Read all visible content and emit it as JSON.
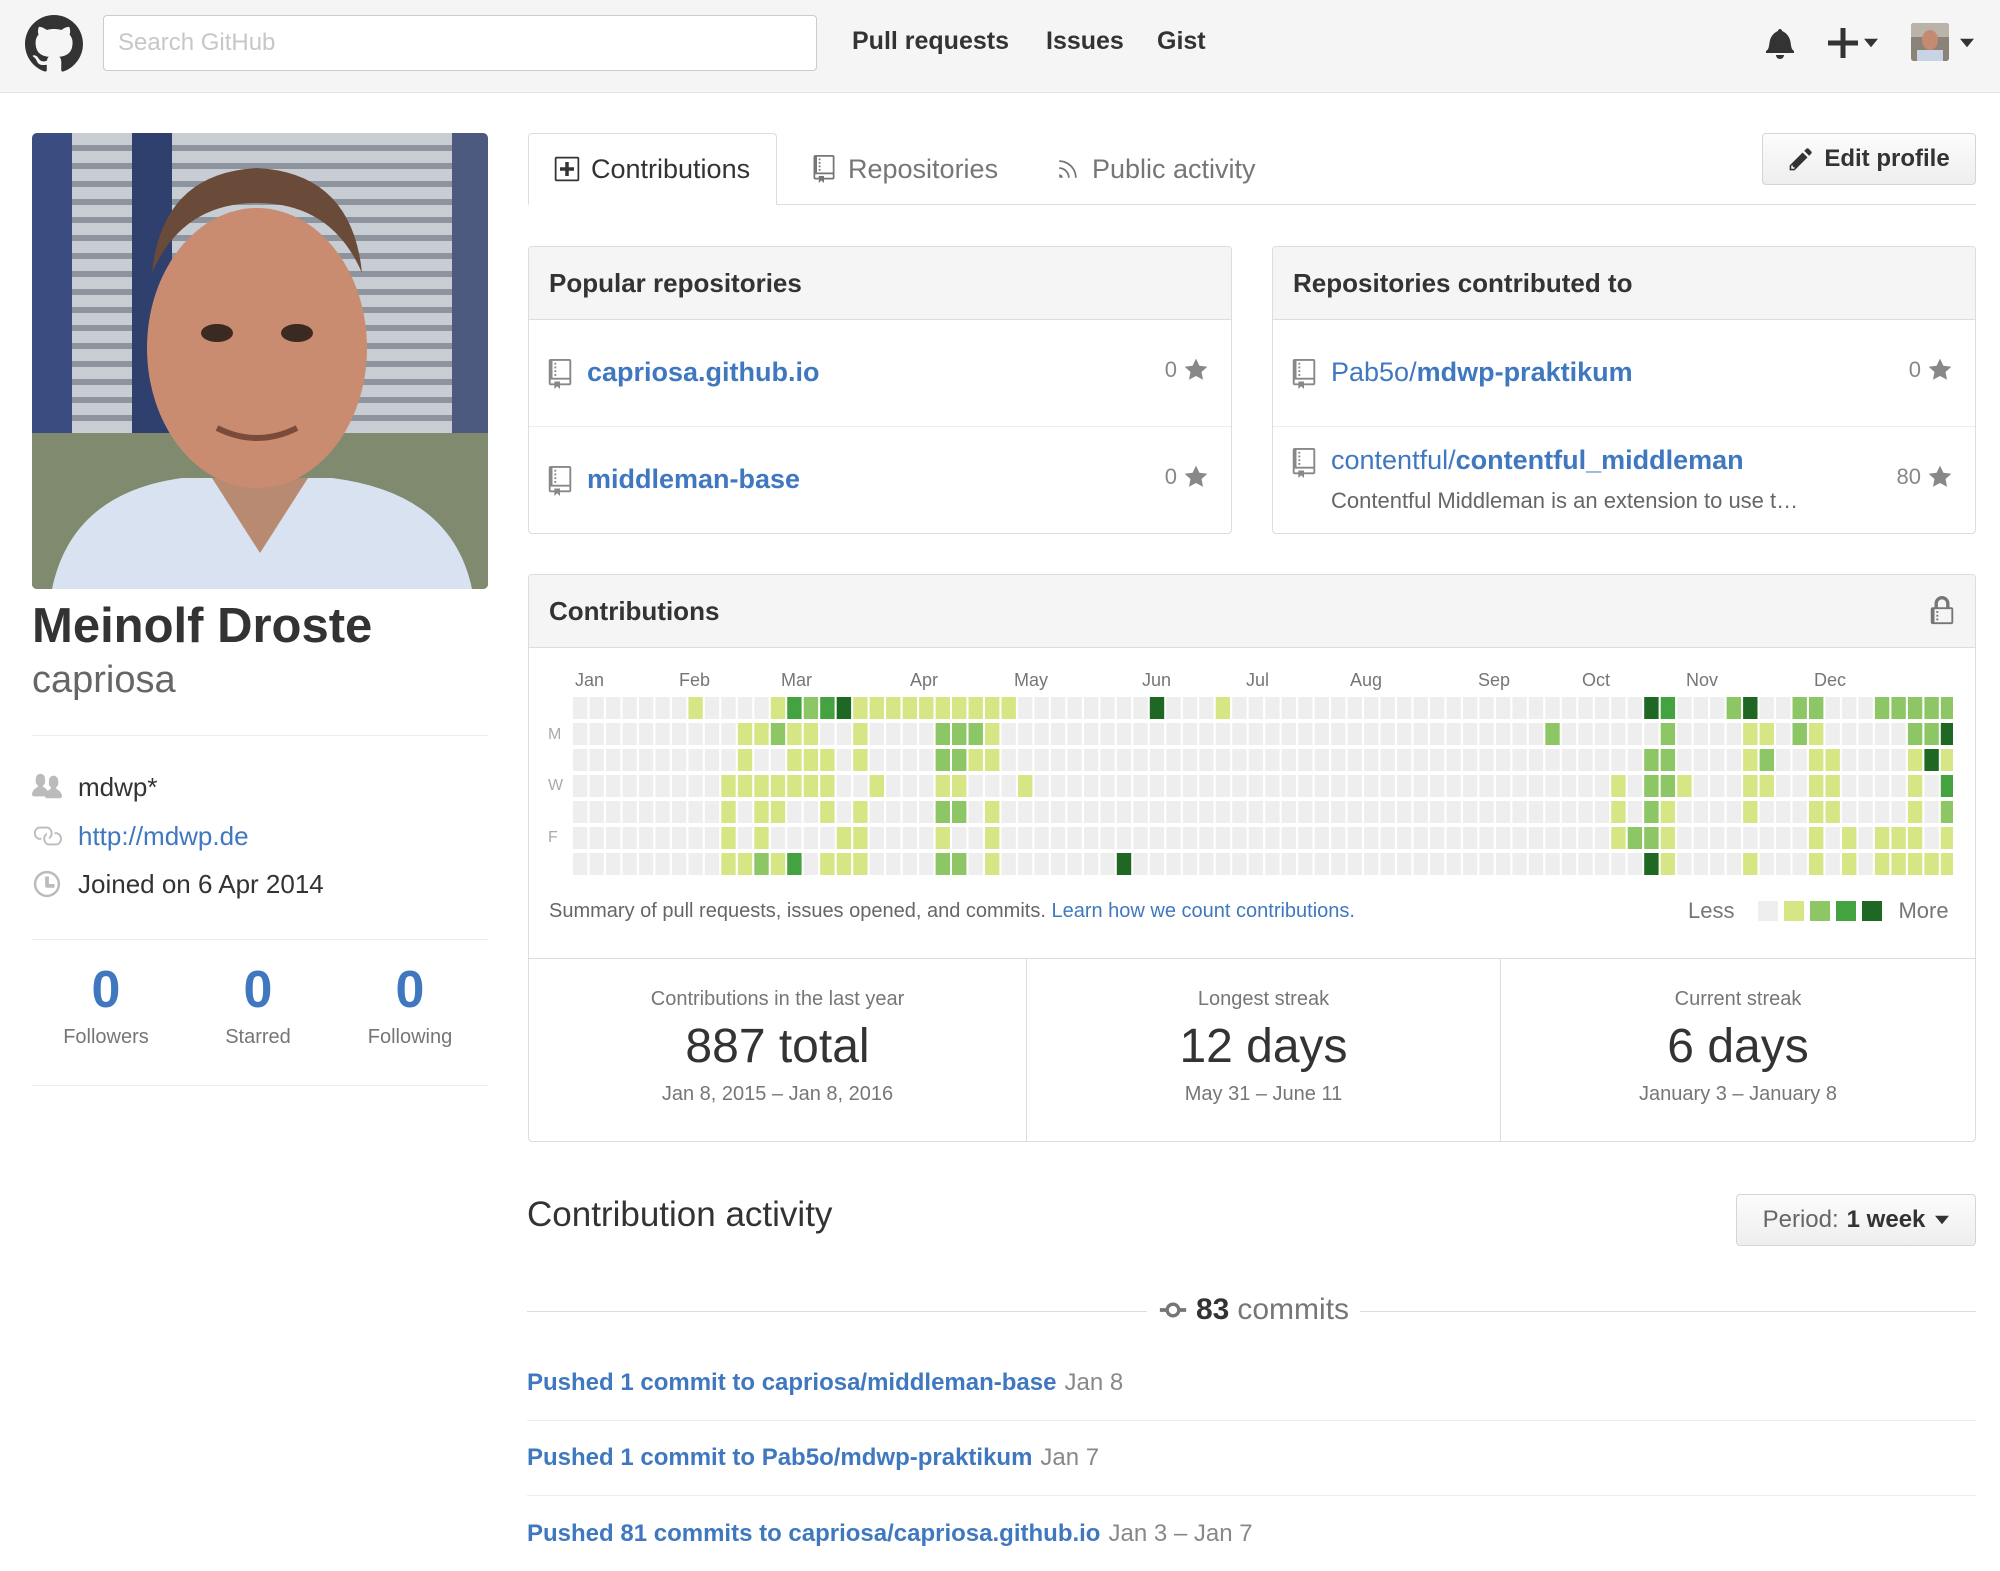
{
  "header": {
    "search_placeholder": "Search GitHub",
    "nav": [
      "Pull requests",
      "Issues",
      "Gist"
    ],
    "icons": [
      "github-logo",
      "bell-icon",
      "plus-icon",
      "avatar-menu"
    ]
  },
  "profile": {
    "name": "Meinolf Droste",
    "login": "capriosa",
    "organization": "mdwp*",
    "website": "http://mdwp.de",
    "joined": "Joined on 6 Apr 2014",
    "stats": [
      {
        "value": "0",
        "label": "Followers"
      },
      {
        "value": "0",
        "label": "Starred"
      },
      {
        "value": "0",
        "label": "Following"
      }
    ]
  },
  "tabs": [
    "Contributions",
    "Repositories",
    "Public activity"
  ],
  "edit_profile": "Edit profile",
  "popular": {
    "title": "Popular repositories",
    "repos": [
      {
        "name": "capriosa.github.io",
        "stars": "0"
      },
      {
        "name": "middleman-base",
        "stars": "0"
      }
    ]
  },
  "contributed": {
    "title": "Repositories contributed to",
    "repos": [
      {
        "owner": "Pab5o/",
        "name": "mdwp-praktikum",
        "stars": "0",
        "desc": ""
      },
      {
        "owner": "contentful/",
        "name": "contentful_middleman",
        "stars": "80",
        "desc": "Contentful Middleman is an extension to use t…"
      }
    ]
  },
  "contributions": {
    "title": "Contributions",
    "months": [
      "Jan",
      "Feb",
      "Mar",
      "Apr",
      "May",
      "Jun",
      "Jul",
      "Aug",
      "Sep",
      "Oct",
      "Nov",
      "Dec"
    ],
    "days": [
      "M",
      "W",
      "F"
    ],
    "summary": "Summary of pull requests, issues opened, and commits.",
    "learn_link": "Learn how we count contributions.",
    "legend_less": "Less",
    "legend_more": "More",
    "levels": [
      "#eeeeee",
      "#d6e685",
      "#8cc665",
      "#44a340",
      "#1e6823"
    ],
    "grid": [
      "0000000",
      "0000000",
      "0000000",
      "0000000",
      "0000000",
      "0000000",
      "0000000",
      "1000000",
      "0000000",
      "0001111",
      "0111001",
      "0101112",
      "1201101",
      "3111003",
      "2111000",
      "3011101",
      "4000011",
      "1110111",
      "1001000",
      "1000000",
      "1000000",
      "1000000",
      "1221212",
      "1221202",
      "1210000",
      "1110111",
      "1000000",
      "0001000",
      "0000000",
      "0000000",
      "0000000",
      "0000000",
      "0000000",
      "0000004",
      "0000000",
      "4000000",
      "0000000",
      "0000000",
      "0000000",
      "1000000",
      "0000000",
      "0000000",
      "0000000",
      "0000000",
      "0000000",
      "0000000",
      "0000000",
      "0000000",
      "0000000",
      "0000000",
      "0000000",
      "0000000",
      "0000000",
      "0000000",
      "0000000",
      "0000000",
      "0000000",
      "0000000",
      "0000000",
      "0200000",
      "0000000",
      "0000000",
      "0000000",
      "0001110",
      "0000020",
      "4022224",
      "3222111",
      "0001000",
      "0000000",
      "0000000",
      "2000000",
      "4111101",
      "0121000",
      "0000000",
      "2200000",
      "2111111",
      "0011100",
      "0000011",
      "0000000",
      "2000011",
      "2000011",
      "2211111",
      "2240001",
      "2413211"
    ]
  },
  "contrib_stats": [
    {
      "label": "Contributions in the last year",
      "value": "887 total",
      "range": "Jan 8, 2015 – Jan 8, 2016"
    },
    {
      "label": "Longest streak",
      "value": "12 days",
      "range": "May 31 – June 11"
    },
    {
      "label": "Current streak",
      "value": "6 days",
      "range": "January 3 – January 8"
    }
  ],
  "activity": {
    "title": "Contribution activity",
    "period_label": "Period:",
    "period_value": "1 week",
    "commit_count": "83",
    "commit_word": "commits",
    "rows": [
      {
        "text": "Pushed 1 commit to capriosa/middleman-base",
        "date": "Jan 8"
      },
      {
        "text": "Pushed 1 commit to Pab5o/mdwp-praktikum",
        "date": "Jan 7"
      },
      {
        "text": "Pushed 81 commits to capriosa/capriosa.github.io",
        "date": "Jan 3 – Jan 7"
      }
    ]
  }
}
